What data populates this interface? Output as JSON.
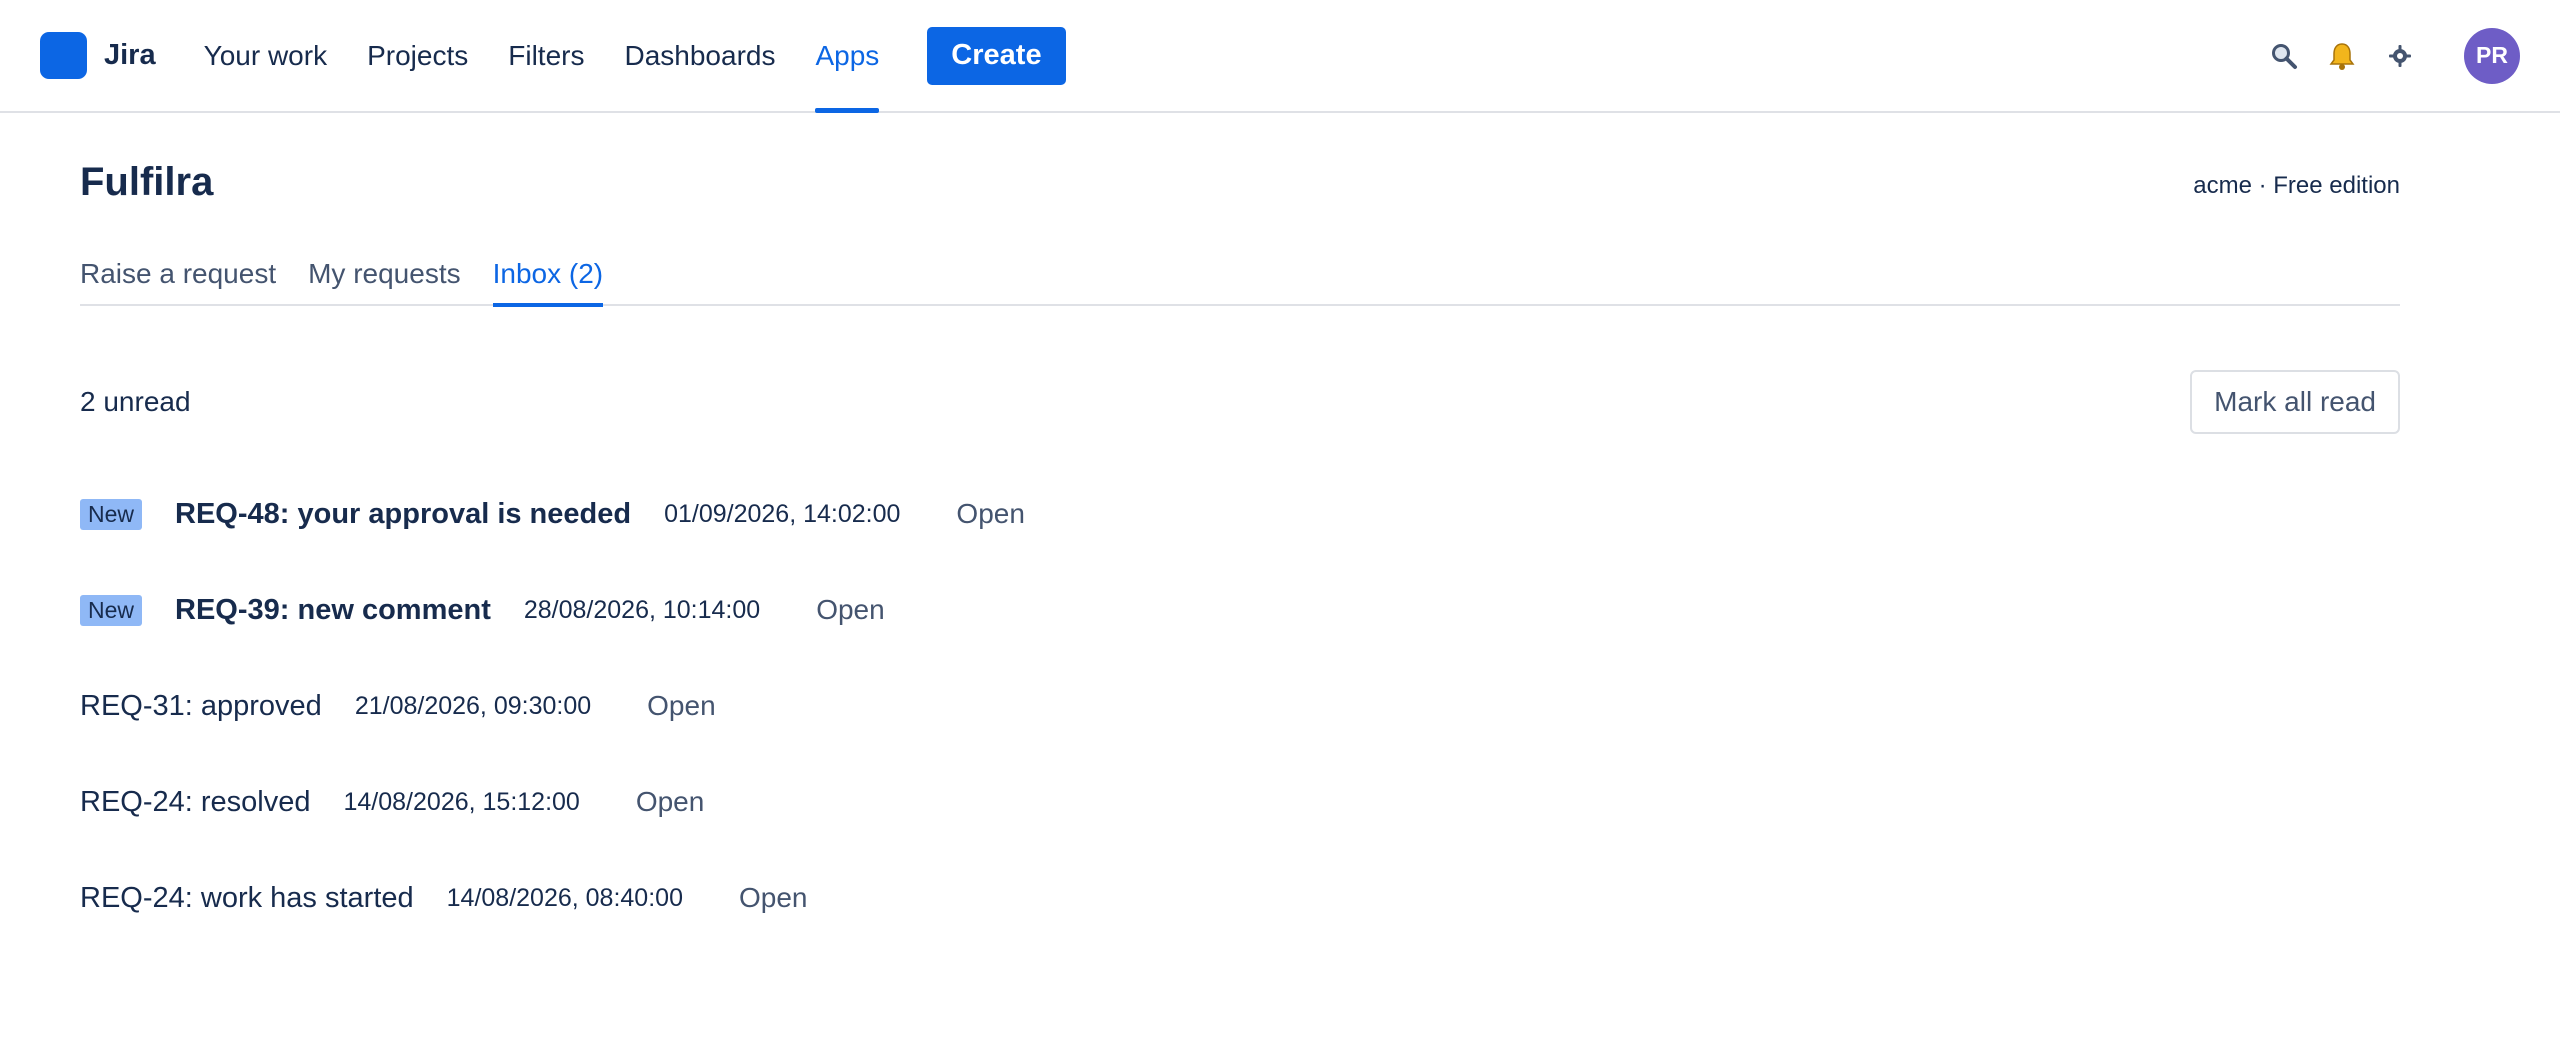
{
  "nav": {
    "logo_text": "Jira",
    "items": [
      {
        "label": "Your work"
      },
      {
        "label": "Projects"
      },
      {
        "label": "Filters"
      },
      {
        "label": "Dashboards"
      },
      {
        "label": "Apps",
        "active": true
      }
    ],
    "create_label": "Create",
    "avatar_initials": "PR",
    "icons": [
      "search-icon",
      "bell-icon",
      "gear-icon"
    ],
    "accent_color": "#0c66e4",
    "avatar_color": "#6e5dc6"
  },
  "page": {
    "title": "Fulfilra",
    "edition": "acme · Free edition"
  },
  "tabs": [
    {
      "label": "Raise a request"
    },
    {
      "label": "My requests"
    },
    {
      "label": "Inbox (2)",
      "active": true
    }
  ],
  "inbox": {
    "unread_text": "2 unread",
    "mark_all_label": "Mark all read",
    "badge_label": "New",
    "badge_color": "#8fb8f6",
    "items": [
      {
        "title": "REQ-48: your approval is needed",
        "time": "01/09/2026, 14:02:00",
        "link": "Open",
        "unread": true
      },
      {
        "title": "REQ-39: new comment",
        "time": "28/08/2026, 10:14:00",
        "link": "Open",
        "unread": true
      },
      {
        "title": "REQ-31: approved",
        "time": "21/08/2026, 09:30:00",
        "link": "Open",
        "unread": false
      },
      {
        "title": "REQ-24: resolved",
        "time": "14/08/2026, 15:12:00",
        "link": "Open",
        "unread": false
      },
      {
        "title": "REQ-24: work has started",
        "time": "14/08/2026, 08:40:00",
        "link": "Open",
        "unread": false
      }
    ]
  }
}
